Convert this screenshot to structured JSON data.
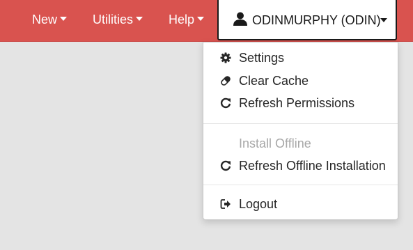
{
  "navbar": {
    "items": [
      {
        "label": "New"
      },
      {
        "label": "Utilities"
      },
      {
        "label": "Help"
      }
    ],
    "user": {
      "label": "ODINMURPHY (ODIN)",
      "icon": "user-icon"
    },
    "background_color": "#d9534f"
  },
  "user_menu": {
    "items": [
      {
        "label": "Settings",
        "icon": "gear-icon",
        "enabled": true
      },
      {
        "label": "Clear Cache",
        "icon": "eraser-icon",
        "enabled": true
      },
      {
        "label": "Refresh Permissions",
        "icon": "refresh-icon",
        "enabled": true
      },
      {
        "label": "Install Offline",
        "icon": "",
        "enabled": false
      },
      {
        "label": "Refresh Offline Installation",
        "icon": "refresh-icon",
        "enabled": true
      },
      {
        "label": "Logout",
        "icon": "logout-icon",
        "enabled": true
      }
    ]
  }
}
